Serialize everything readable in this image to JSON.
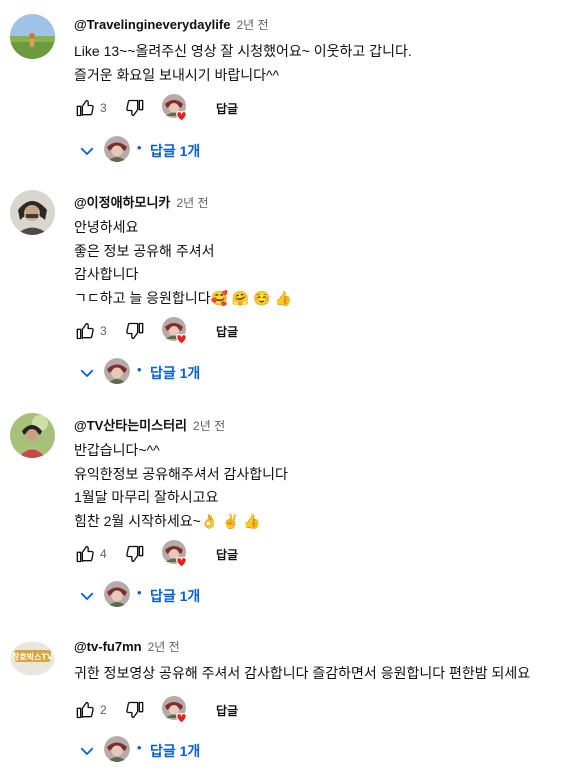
{
  "comments": [
    {
      "author": "@Travelingineverydaylife",
      "time": "2년 전",
      "lines": [
        "Like 13~~올려주신 영상 잘 시청했어요~ 이웃하고 갑니다.",
        "즐거운 화요일 보내시기 바랍니다^^"
      ],
      "likes": "3",
      "reply_label": "답글",
      "replies_label": "답글 1개"
    },
    {
      "author": "@이정애하모니카",
      "time": "2년 전",
      "lines": [
        "안녕하세요",
        "좋은 정보 공유해 주셔서",
        "감사합니다",
        "ㄱㄷ하고 늘 응원합니다🥰 🤗 ☺️ 👍"
      ],
      "likes": "3",
      "reply_label": "답글",
      "replies_label": "답글 1개"
    },
    {
      "author": "@TV산타는미스터리",
      "time": "2년 전",
      "lines": [
        "반갑습니다~^^",
        "유익한정보 공유해주셔서 감사합니다",
        "1월달 마무리 잘하시고요",
        "힘찬 2월 시작하세요~👌 ✌️ 👍"
      ],
      "likes": "4",
      "reply_label": "답글",
      "replies_label": "답글 1개"
    },
    {
      "author": "@tv-fu7mn",
      "time": "2년 전",
      "lines": [
        "귀한 정보영상 공유해 주셔서 감사합니다 즐감하면서 응원합니다 편한밤 되세요"
      ],
      "likes": "2",
      "reply_label": "답글",
      "replies_label": "답글 1개"
    }
  ],
  "icons": {
    "like": "thumb-up-icon",
    "dislike": "thumb-down-icon",
    "heart": "creator-heart-icon",
    "expand": "chevron-down-icon"
  },
  "colors": {
    "link_blue": "#065fd4",
    "heart_red": "#e62117",
    "muted": "#606060"
  },
  "avatar_badge_4": "창호박스TV"
}
